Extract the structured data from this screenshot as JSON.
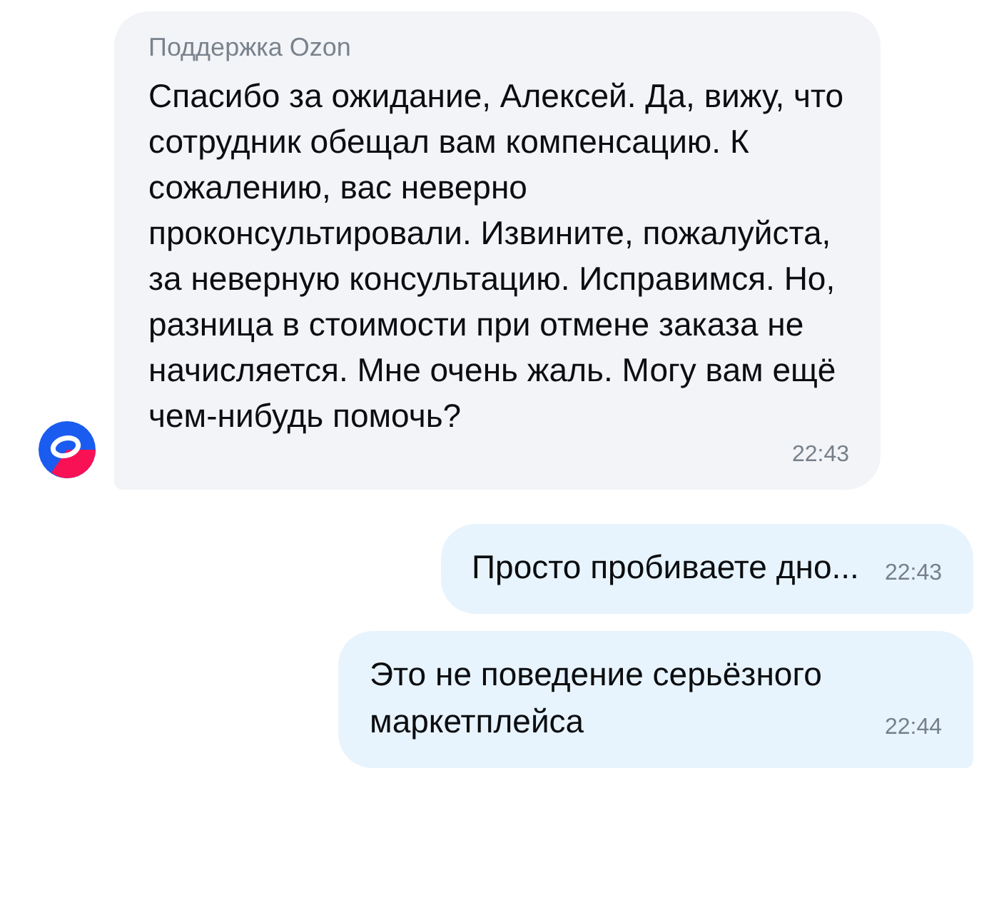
{
  "messages": [
    {
      "kind": "incoming",
      "sender": "Поддержка Ozon",
      "text": "Спасибо за ожидание, Алексей. Да, вижу, что сотрудник обещал вам компенсацию. К сожалению, вас неверно проконсультировали. Извините, пожалуйста, за неверную консультацию. Исправимся. Но, разница в стоимости при отмене заказа не начисляется. Мне очень жаль. Могу вам ещё чем-нибудь помочь?",
      "time": "22:43"
    },
    {
      "kind": "outgoing",
      "text": "Просто пробиваете дно...",
      "time": "22:43"
    },
    {
      "kind": "outgoing",
      "text": "Это не поведение серьёзного маркетплейса",
      "time": "22:44"
    }
  ]
}
